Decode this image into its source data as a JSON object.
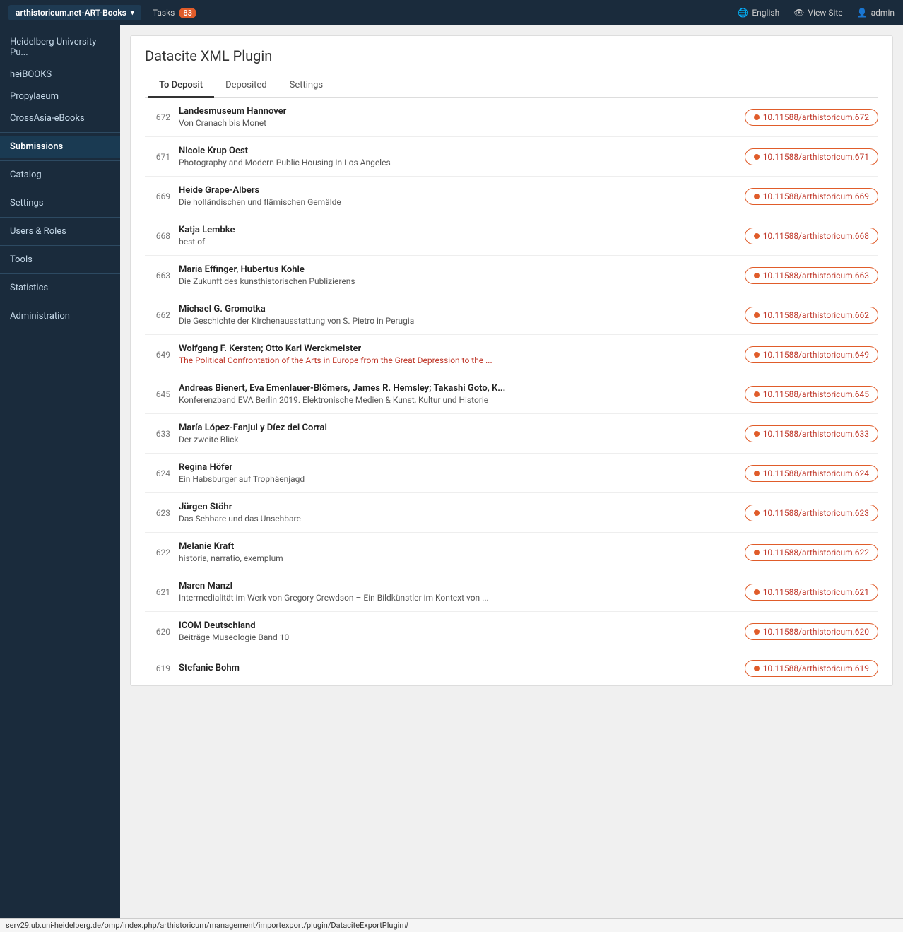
{
  "topbar": {
    "brand": "arthistoricum.net-ART-Books",
    "tasks_label": "Tasks",
    "tasks_count": "83",
    "lang_label": "English",
    "viewsite_label": "View Site",
    "admin_label": "admin"
  },
  "sidebar": {
    "items": [
      {
        "id": "heidelberg",
        "label": "Heidelberg University Pu..."
      },
      {
        "id": "heibooks",
        "label": "heiBOOKS"
      },
      {
        "id": "propylaeum",
        "label": "Propylaeum"
      },
      {
        "id": "crossasia",
        "label": "CrossAsia-eBooks"
      },
      {
        "id": "submissions",
        "label": "Submissions",
        "active": true
      },
      {
        "id": "catalog",
        "label": "Catalog"
      },
      {
        "id": "settings",
        "label": "Settings"
      },
      {
        "id": "users",
        "label": "Users & Roles"
      },
      {
        "id": "tools",
        "label": "Tools"
      },
      {
        "id": "statistics",
        "label": "Statistics"
      },
      {
        "id": "administration",
        "label": "Administration"
      }
    ]
  },
  "plugin": {
    "title": "Datacite XML Plugin",
    "tabs": [
      {
        "id": "to-deposit",
        "label": "To Deposit",
        "active": true
      },
      {
        "id": "deposited",
        "label": "Deposited"
      },
      {
        "id": "settings",
        "label": "Settings"
      }
    ]
  },
  "items": [
    {
      "number": "672",
      "title": "Landesmuseum Hannover",
      "subtitle": "Von Cranach bis Monet",
      "subtitle_red": false,
      "doi": "10.11588/arthistoricum.672"
    },
    {
      "number": "671",
      "title": "Nicole Krup Oest",
      "subtitle": "Photography and Modern Public Housing In Los Angeles",
      "subtitle_red": false,
      "doi": "10.11588/arthistoricum.671"
    },
    {
      "number": "669",
      "title": "Heide Grape-Albers",
      "subtitle": "Die holländischen und flämischen Gemälde",
      "subtitle_red": false,
      "doi": "10.11588/arthistoricum.669"
    },
    {
      "number": "668",
      "title": "Katja Lembke",
      "subtitle": "best of",
      "subtitle_red": false,
      "doi": "10.11588/arthistoricum.668"
    },
    {
      "number": "663",
      "title": "Maria Effinger, Hubertus Kohle",
      "subtitle": "Die Zukunft des kunsthistorischen Publizierens",
      "subtitle_red": false,
      "doi": "10.11588/arthistoricum.663"
    },
    {
      "number": "662",
      "title": "Michael G. Gromotka",
      "subtitle": "Die Geschichte der Kirchenausstattung von S. Pietro in Perugia",
      "subtitle_red": false,
      "doi": "10.11588/arthistoricum.662"
    },
    {
      "number": "649",
      "title": "Wolfgang F. Kersten; Otto Karl Werckmeister",
      "subtitle": "The Political Confrontation of the Arts in Europe from the Great Depression to the ...",
      "subtitle_red": true,
      "doi": "10.11588/arthistoricum.649"
    },
    {
      "number": "645",
      "title": "Andreas Bienert, Eva Emenlauer-Blömers, James R. Hemsley; Takashi Goto, K...",
      "subtitle": "Konferenzband EVA Berlin 2019. Elektronische Medien & Kunst, Kultur und Historie",
      "subtitle_red": false,
      "doi": "10.11588/arthistoricum.645"
    },
    {
      "number": "633",
      "title": "María López-Fanjul y Díez del Corral",
      "subtitle": "Der zweite Blick",
      "subtitle_red": false,
      "doi": "10.11588/arthistoricum.633"
    },
    {
      "number": "624",
      "title": "Regina Höfer",
      "subtitle": "Ein Habsburger auf Trophäenjagd",
      "subtitle_red": false,
      "doi": "10.11588/arthistoricum.624"
    },
    {
      "number": "623",
      "title": "Jürgen Stöhr",
      "subtitle": "Das Sehbare und das Unsehbare",
      "subtitle_red": false,
      "doi": "10.11588/arthistoricum.623"
    },
    {
      "number": "622",
      "title": "Melanie Kraft",
      "subtitle": "historia, narratio, exemplum",
      "subtitle_red": false,
      "doi": "10.11588/arthistoricum.622"
    },
    {
      "number": "621",
      "title": "Maren Manzl",
      "subtitle": "Intermedialität im Werk von Gregory Crewdson – Ein Bildkünstler im Kontext von ...",
      "subtitle_red": false,
      "doi": "10.11588/arthistoricum.621"
    },
    {
      "number": "620",
      "title": "ICOM Deutschland",
      "subtitle": "Beiträge Museologie Band 10",
      "subtitle_red": false,
      "doi": "10.11588/arthistoricum.620"
    },
    {
      "number": "619",
      "title": "Stefanie Bohm",
      "subtitle": "",
      "subtitle_red": false,
      "doi": "10.11588/arthistoricum.619"
    }
  ],
  "statusbar": {
    "url": "serv29.ub.uni-heidelberg.de/omp/index.php/arthistoricum/management/importexport/plugin/DataciteExportPlugin#"
  }
}
